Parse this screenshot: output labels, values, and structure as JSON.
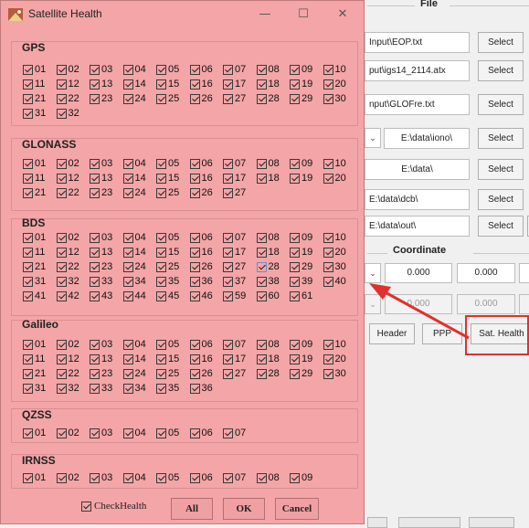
{
  "dialog": {
    "title": "Satellite Health",
    "minimize_glyph": "—",
    "maximize_glyph": "☐",
    "close_glyph": "✕",
    "icon": "satellite-app-icon",
    "groups": [
      {
        "label": "GPS",
        "sats": [
          "01",
          "02",
          "03",
          "04",
          "05",
          "06",
          "07",
          "08",
          "09",
          "10",
          "11",
          "12",
          "13",
          "14",
          "15",
          "16",
          "17",
          "18",
          "19",
          "20",
          "21",
          "22",
          "23",
          "24",
          "25",
          "26",
          "27",
          "28",
          "29",
          "30",
          "31",
          "32"
        ]
      },
      {
        "label": "GLONASS",
        "sats": [
          "01",
          "02",
          "03",
          "04",
          "05",
          "06",
          "07",
          "08",
          "09",
          "10",
          "11",
          "12",
          "13",
          "14",
          "15",
          "16",
          "17",
          "18",
          "19",
          "20",
          "21",
          "22",
          "23",
          "24",
          "25",
          "26",
          "27"
        ]
      },
      {
        "label": "BDS",
        "sats": [
          "01",
          "02",
          "03",
          "04",
          "05",
          "06",
          "07",
          "08",
          "09",
          "10",
          "11",
          "12",
          "13",
          "14",
          "15",
          "16",
          "17",
          "18",
          "19",
          "20",
          "21",
          "22",
          "23",
          "24",
          "25",
          "26",
          "27",
          "28",
          "29",
          "30",
          "31",
          "32",
          "33",
          "34",
          "35",
          "36",
          "37",
          "38",
          "39",
          "40",
          "41",
          "42",
          "43",
          "44",
          "45",
          "46",
          "59",
          "60",
          "61"
        ]
      },
      {
        "label": "Galileo",
        "sats": [
          "01",
          "02",
          "03",
          "04",
          "05",
          "06",
          "07",
          "08",
          "09",
          "10",
          "11",
          "12",
          "13",
          "14",
          "15",
          "16",
          "17",
          "18",
          "19",
          "20",
          "21",
          "22",
          "23",
          "24",
          "25",
          "26",
          "27",
          "28",
          "29",
          "30",
          "31",
          "32",
          "33",
          "34",
          "35",
          "36"
        ]
      },
      {
        "label": "QZSS",
        "sats": [
          "01",
          "02",
          "03",
          "04",
          "05",
          "06",
          "07"
        ]
      },
      {
        "label": "IRNSS",
        "sats": [
          "01",
          "02",
          "03",
          "04",
          "05",
          "06",
          "07",
          "08",
          "09"
        ]
      }
    ],
    "footer": {
      "check_health_label": "CheckHealth",
      "all_label": "All",
      "ok_label": "OK",
      "cancel_label": "Cancel"
    }
  },
  "main": {
    "file_section_title": "File",
    "coordinate_section_title": "Coordinate",
    "file_rows": [
      {
        "path": "Input\\EOP.txt",
        "button": "Select"
      },
      {
        "path": "put\\igs14_2114.atx",
        "button": "Select"
      },
      {
        "path": "nput\\GLOFre.txt",
        "button": "Select"
      },
      {
        "path": "E:\\data\\iono\\",
        "button": "Select"
      },
      {
        "path": "E:\\data\\",
        "button": "Select"
      },
      {
        "path": "E:\\data\\dcb\\",
        "button": "Select"
      },
      {
        "path": "E:\\data\\out\\",
        "button": "Select"
      }
    ],
    "coord_row1": [
      "0.000",
      "0.000"
    ],
    "coord_row2": [
      "0.000",
      "0.000"
    ],
    "buttons": {
      "header": "Header",
      "ppp": "PPP",
      "sat_health": "Sat. Health"
    },
    "highlight_color": "#e03030"
  }
}
